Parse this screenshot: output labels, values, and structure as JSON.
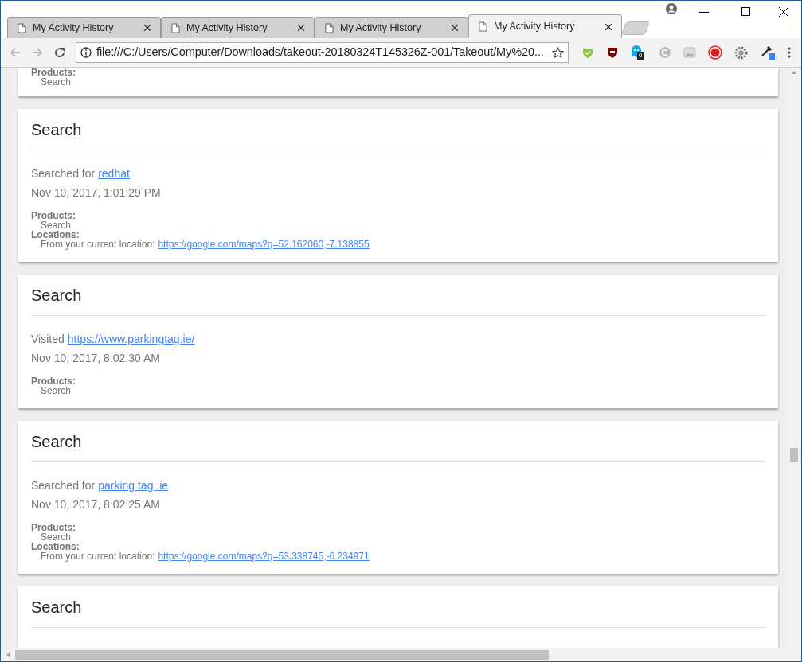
{
  "tabs": [
    {
      "title": "My Activity History",
      "selected": false
    },
    {
      "title": "My Activity History",
      "selected": false
    },
    {
      "title": "My Activity History",
      "selected": false
    },
    {
      "title": "My Activity History",
      "selected": true
    }
  ],
  "address_bar": {
    "url": "file:///C:/Users/Computer/Downloads/takeout-20180324T145326Z-001/Takeout/My%20..."
  },
  "extension_badge": "0",
  "cards": [
    {
      "kind": "partial",
      "products_label": "Products:",
      "products": [
        "Search"
      ]
    },
    {
      "kind": "full",
      "title": "Search",
      "action": "Searched for",
      "link": "redhat",
      "time": "Nov 10, 2017, 1:01:29 PM",
      "products_label": "Products:",
      "products": [
        "Search"
      ],
      "locations_label": "Locations:",
      "locations": [
        {
          "text": "From your current location:",
          "link": "https://google.com/maps?q=52.162060,-7.138855"
        }
      ]
    },
    {
      "kind": "full",
      "title": "Search",
      "action": "Visited",
      "link": "https://www.parkingtag.ie/",
      "time": "Nov 10, 2017, 8:02:30 AM",
      "products_label": "Products:",
      "products": [
        "Search"
      ]
    },
    {
      "kind": "full",
      "title": "Search",
      "action": "Searched for",
      "link": "parking tag .ie",
      "time": "Nov 10, 2017, 8:02:25 AM",
      "products_label": "Products:",
      "products": [
        "Search"
      ],
      "locations_label": "Locations:",
      "locations": [
        {
          "text": "From your current location:",
          "link": "https://google.com/maps?q=53.338745,-6.234971"
        }
      ]
    },
    {
      "kind": "header",
      "title": "Search"
    }
  ]
}
